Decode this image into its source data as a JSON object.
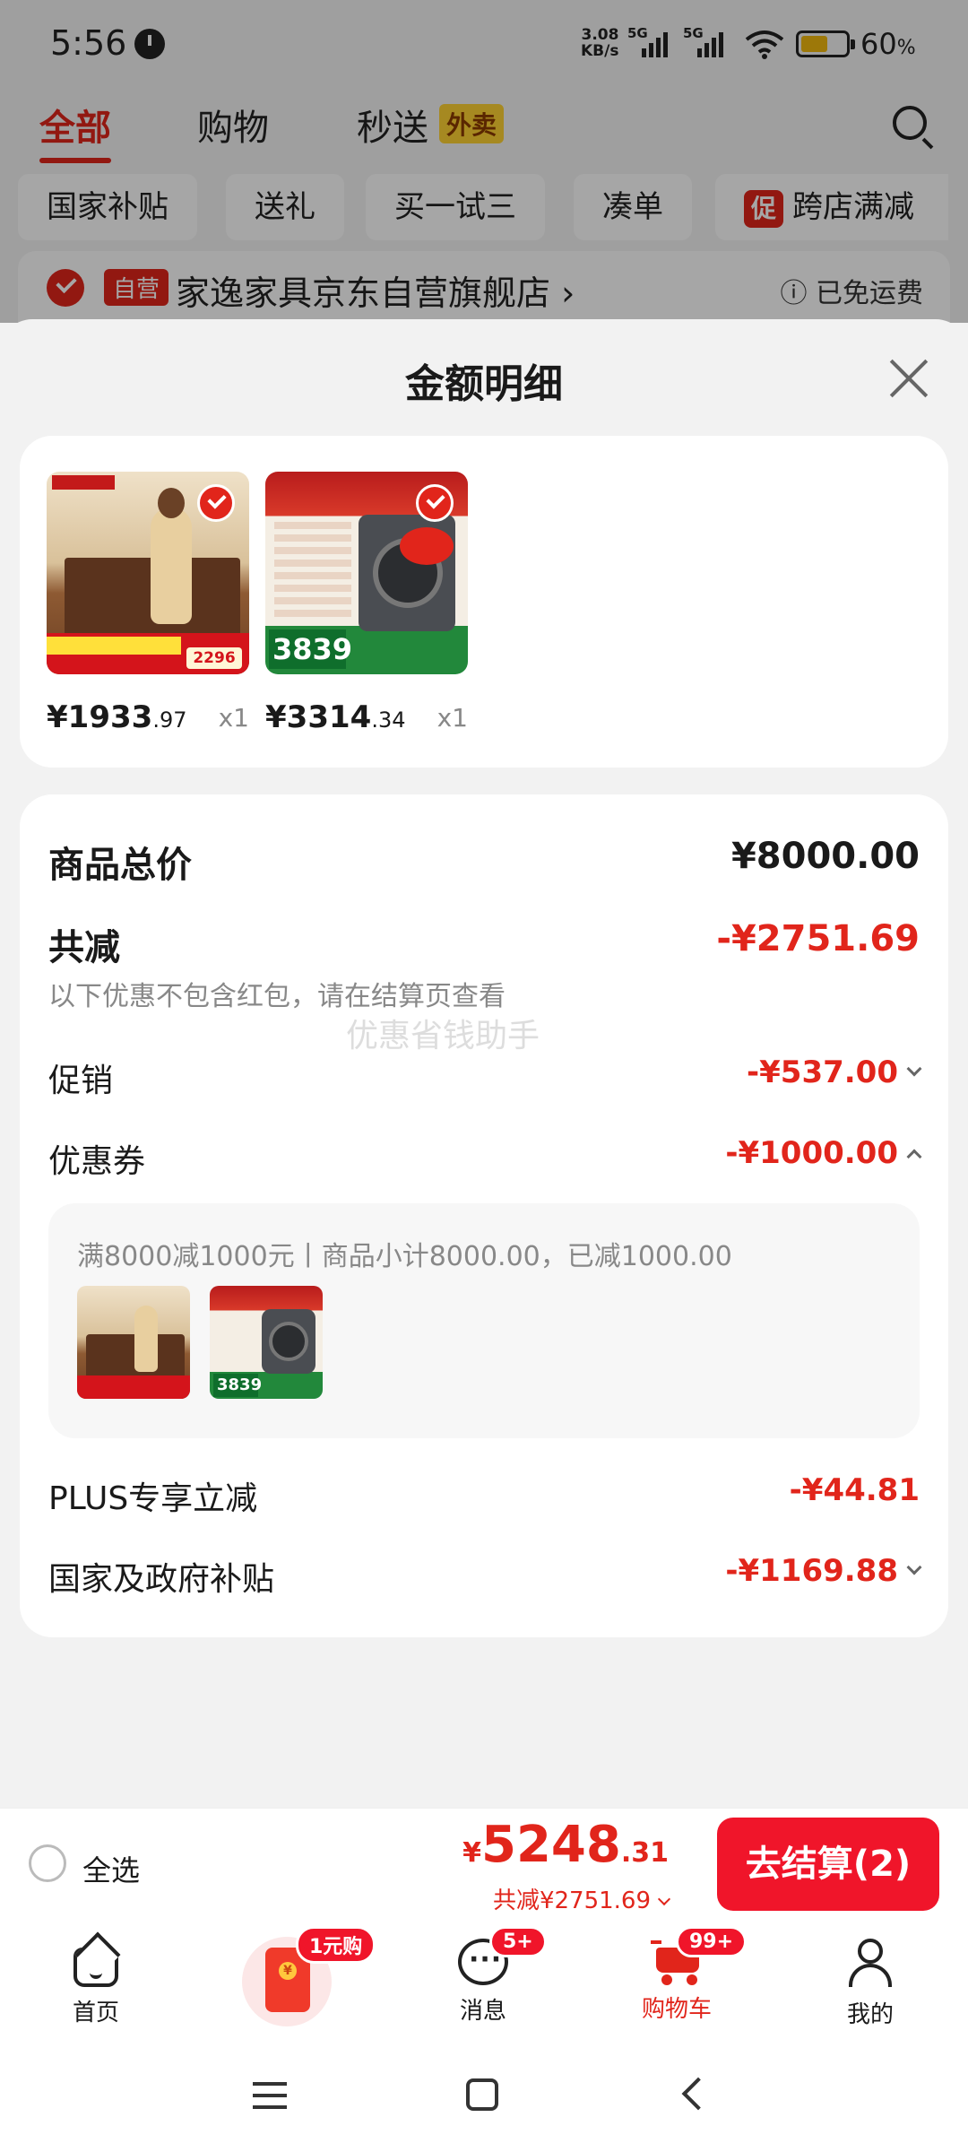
{
  "status_bar": {
    "time": "5:56",
    "net_speed_value": "3.08",
    "net_speed_unit": "KB/s",
    "sim1": "5G",
    "sim2": "5G",
    "battery_pct": "60",
    "battery_unit": "%",
    "battery_level": 0.6
  },
  "top_tabs": {
    "items": [
      {
        "label": "全部",
        "active": true
      },
      {
        "label": "购物",
        "active": false
      },
      {
        "label": "秒送",
        "active": false
      }
    ],
    "waimai_badge": "外卖"
  },
  "filter_chips": {
    "items": [
      "国家补贴",
      "送礼",
      "买一试三",
      "凑单",
      "跨店满减"
    ],
    "promo_badge": "促"
  },
  "store": {
    "badge": "自营",
    "name": "家逸家具京东自营旗舰店",
    "name_suffix": "›",
    "shipping": "ⓘ 已免运费"
  },
  "sheet": {
    "title": "金额明细",
    "products": [
      {
        "name": "furniture-desk",
        "currency": "¥",
        "price_int": "1933",
        "price_dec": ".97",
        "qty": "x1",
        "thumb_price": "2296"
      },
      {
        "name": "washing-machine",
        "currency": "¥",
        "price_int": "3314",
        "price_dec": ".34",
        "qty": "x1",
        "thumb_price": "3839"
      }
    ],
    "total_label": "商品总价",
    "total_value": "¥8000.00",
    "discount_label": "共减",
    "discount_value": "-¥2751.69",
    "note": "以下优惠不包含红包，请在结算页查看",
    "watermark": "优惠省钱助手",
    "promo_label": "促销",
    "promo_value": "-¥537.00",
    "coupon_label": "优惠券",
    "coupon_value": "-¥1000.00",
    "coupon_desc": "满8000减1000元丨商品小计8000.00，已减1000.00",
    "plus_label": "PLUS专享立减",
    "plus_value": "-¥44.81",
    "subsidy_label": "国家及政府补贴",
    "subsidy_value": "-¥1169.88"
  },
  "checkout": {
    "select_all": "全选",
    "currency": "¥",
    "total_int": "5248",
    "total_dec": ".31",
    "saved_text": "共减¥2751.69",
    "button": "去结算(2)"
  },
  "tabbar": {
    "items": [
      {
        "label": "首页"
      },
      {
        "label": ""
      },
      {
        "label": "消息"
      },
      {
        "label": "购物车"
      },
      {
        "label": "我的"
      }
    ],
    "redpack_badge": "1元购",
    "msg_badge": "5+",
    "cart_badge": "99+"
  },
  "colors": {
    "brand_red": "#e1251b",
    "checkout_red": "#f0152a"
  }
}
